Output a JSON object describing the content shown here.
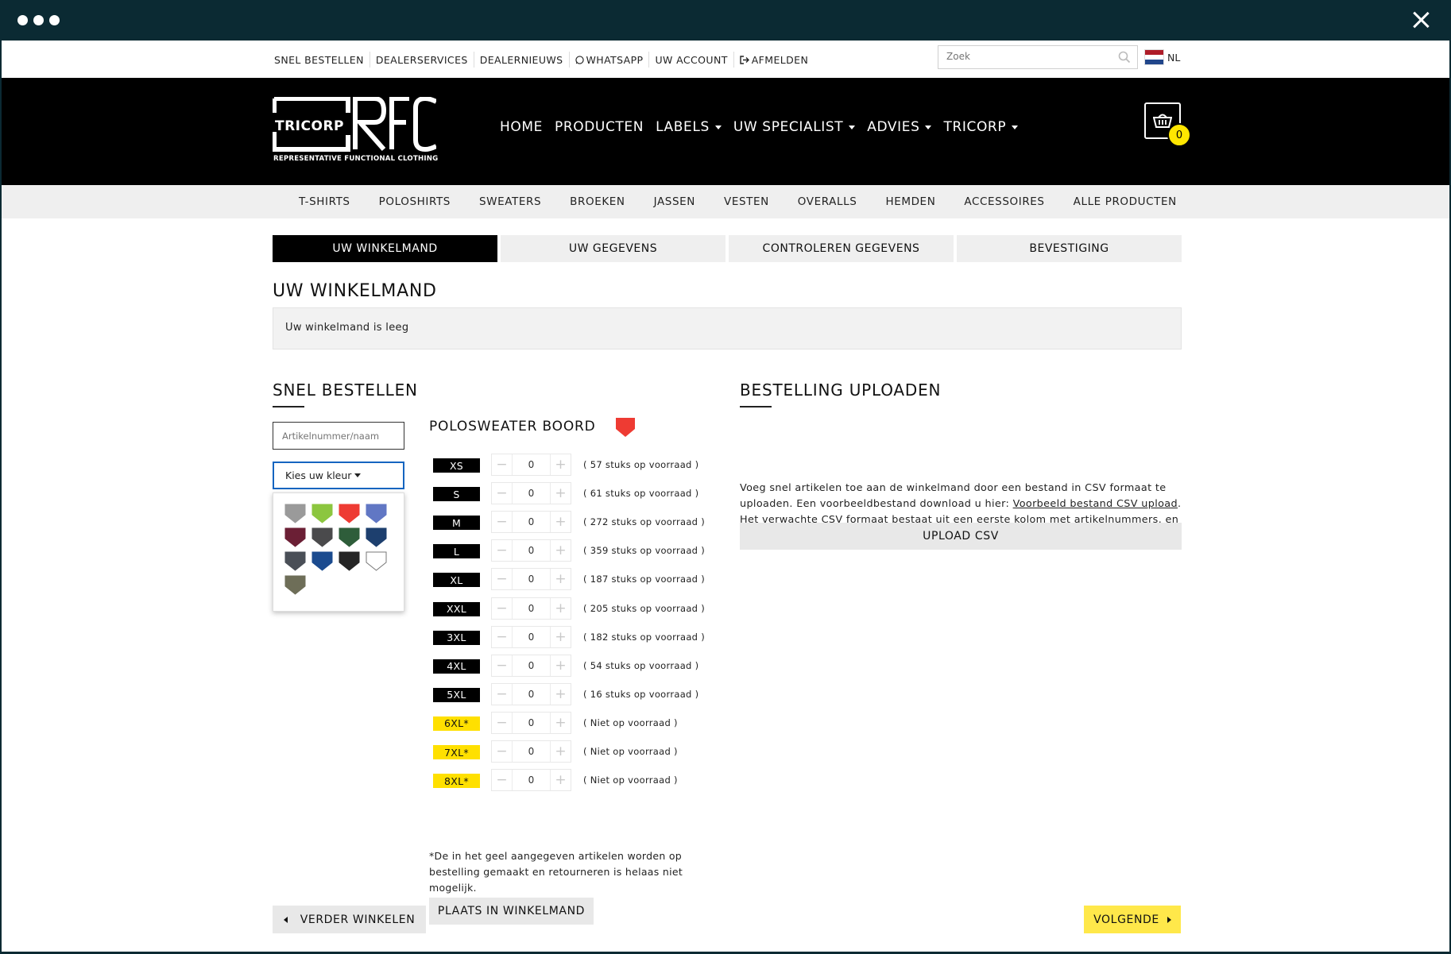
{
  "utility_nav": {
    "links": [
      "SNEL BESTELLEN",
      "DEALERSERVICES",
      "DEALERNIEUWS",
      "WHATSAPP",
      "UW ACCOUNT",
      "AFMELDEN"
    ],
    "search_placeholder": "Zoek",
    "language": "NL"
  },
  "logo": {
    "brand": "TRICORP",
    "tagline": "REPRESENTATIVE FUNCTIONAL CLOTHING"
  },
  "main_nav": {
    "items": [
      "HOME",
      "PRODUCTEN",
      "LABELS",
      "UW SPECIALIST",
      "ADVIES",
      "TRICORP"
    ]
  },
  "cart": {
    "count": "0"
  },
  "categories": [
    "T-SHIRTS",
    "POLOSHIRTS",
    "SWEATERS",
    "BROEKEN",
    "JASSEN",
    "VESTEN",
    "OVERALLS",
    "HEMDEN",
    "ACCESSOIRES",
    "ALLE PRODUCTEN"
  ],
  "steps": [
    "UW WINKELMAND",
    "UW GEGEVENS",
    "CONTROLEREN GEGEVENS",
    "BEVESTIGING"
  ],
  "cart_section": {
    "title": "UW WINKELMAND",
    "empty_message": "Uw winkelmand is leeg"
  },
  "quick_order": {
    "title": "SNEL BESTELLEN",
    "article_placeholder": "Artikelnummer/naam",
    "color_select_label": "Kies uw kleur",
    "swatch_colors": [
      "#9a9a9a",
      "#8cc63f",
      "#ee3b33",
      "#6177c4",
      "#6b1f35",
      "#4a4a4c",
      "#2e5d3a",
      "#1d3f6e",
      "#4a4f57",
      "#1b4b8f",
      "#252525",
      "#ffffff",
      "#6e6e58"
    ],
    "product_title": "POLOSWEATER BOORD",
    "product_color": "#ee3b33",
    "sizes": [
      {
        "size": "XS",
        "qty": "0",
        "stock": "( 57 stuks op voorraad )",
        "yellow": false
      },
      {
        "size": "S",
        "qty": "0",
        "stock": "( 61 stuks op voorraad )",
        "yellow": false
      },
      {
        "size": "M",
        "qty": "0",
        "stock": "( 272 stuks op voorraad )",
        "yellow": false
      },
      {
        "size": "L",
        "qty": "0",
        "stock": "( 359 stuks op voorraad )",
        "yellow": false
      },
      {
        "size": "XL",
        "qty": "0",
        "stock": "( 187 stuks op voorraad )",
        "yellow": false
      },
      {
        "size": "XXL",
        "qty": "0",
        "stock": "( 205 stuks op voorraad )",
        "yellow": false
      },
      {
        "size": "3XL",
        "qty": "0",
        "stock": "( 182 stuks op voorraad )",
        "yellow": false
      },
      {
        "size": "4XL",
        "qty": "0",
        "stock": "( 54 stuks op voorraad )",
        "yellow": false
      },
      {
        "size": "5XL",
        "qty": "0",
        "stock": "( 16 stuks op voorraad )",
        "yellow": false
      },
      {
        "size": "6XL*",
        "qty": "0",
        "stock": "( Niet op voorraad )",
        "yellow": true
      },
      {
        "size": "7XL*",
        "qty": "0",
        "stock": "( Niet op voorraad )",
        "yellow": true
      },
      {
        "size": "8XL*",
        "qty": "0",
        "stock": "( Niet op voorraad )",
        "yellow": true
      }
    ],
    "footnote": "*De in het geel aangegeven artikelen worden op bestelling gemaakt en retourneren is helaas niet mogelijk.",
    "add_button": "PLAATS IN WINKELMAND"
  },
  "upload": {
    "title": "BESTELLING UPLOADEN",
    "text_before_link": "Voeg snel artikelen toe aan de winkelmand door een bestand in CSV formaat te uploaden. Een voorbeeldbestand download u hier: ",
    "link_text": "Voorbeeld bestand CSV upload",
    "text_after_link": ". Het verwachte CSV formaat bestaat uit een eerste kolom met artikelnummers, en een tweede kolom met het gewenste aantal van het desbetreffende artikel.",
    "button": "UPLOAD CSV"
  },
  "footer_buttons": {
    "back": "VERDER WINKELEN",
    "next": "VOLGENDE"
  }
}
